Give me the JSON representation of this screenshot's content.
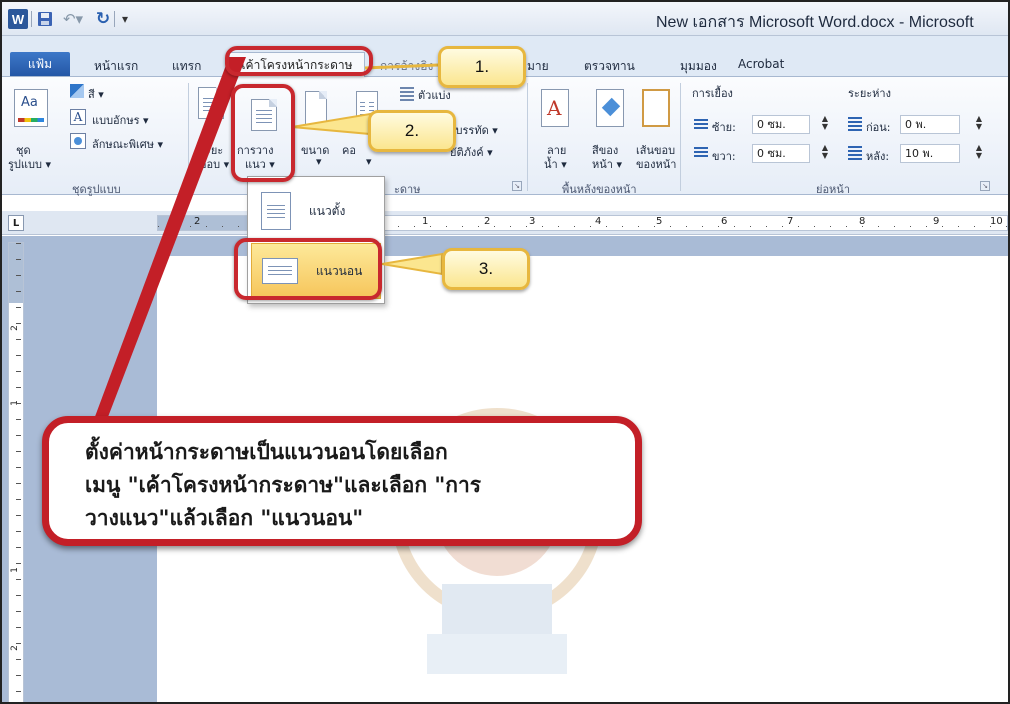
{
  "titlebar": {
    "logo_letter": "W",
    "window_title": "New เอกสาร Microsoft Word.docx - Microsoft",
    "qa_menu_glyph": "▾"
  },
  "tabs": {
    "file": "แฟ้ม",
    "home": "หน้าแรก",
    "insert": "แทรก",
    "page_layout": "เค้าโครงหน้ากระดาษ",
    "references_partial": "การอ้างอิง",
    "mailings_partial": "มาย",
    "review": "ตรวจทาน",
    "view": "มุมมอง",
    "acrobat": "Acrobat"
  },
  "ribbon": {
    "themes": {
      "themes_label_line1": "ชุด",
      "themes_label_line2": "รูปแบบ ▾",
      "colors": "สี ▾",
      "fonts": "แบบอักษร ▾",
      "effects": "ลักษณะพิเศษ ▾",
      "group_label": "ชุดรูปแบบ"
    },
    "page_setup": {
      "margins_line1": "ระยะ",
      "margins_line2": "ขอบ ▾",
      "orientation_line1": "การวาง",
      "orientation_line2": "แนว ▾",
      "size": "ขนาด",
      "columns_partial": "คอ",
      "breaks_partial": "ตัวแบ่ง",
      "line_numbers_partial": "ขบรรทัด ▾",
      "hyphenation_partial": "ยัติภังค์ ▾",
      "group_label_partial": "ะดาษ"
    },
    "page_background": {
      "watermark_line1": "ลาย",
      "watermark_line2": "น้ำ ▾",
      "page_color_line1": "สีของ",
      "page_color_line2": "หน้า ▾",
      "page_borders_line1": "เส้นขอบ",
      "page_borders_line2": "ของหน้า",
      "group_label": "พื้นหลังของหน้า"
    },
    "paragraph": {
      "indent_title": "การเยื้อง",
      "indent_left_label": "ซ้าย:",
      "indent_left_value": "0 ซม.",
      "indent_right_label": "ขวา:",
      "indent_right_value": "0 ซม.",
      "spacing_title": "ระยะห่าง",
      "spacing_before_label": "ก่อน:",
      "spacing_before_value": "0 พ.",
      "spacing_after_label": "หลัง:",
      "spacing_after_value": "10 พ.",
      "group_label": "ย่อหน้า"
    }
  },
  "dropdown": {
    "portrait": "แนวตั้ง",
    "landscape": "แนวนอน"
  },
  "ruler": {
    "tab_selector": "L",
    "h_numbers": [
      "2",
      "1",
      "1",
      "2",
      "3",
      "4",
      "5",
      "6",
      "7",
      "8",
      "9",
      "10"
    ],
    "v_numbers": [
      "2",
      "1",
      "1",
      "2"
    ]
  },
  "callouts": {
    "step1": "1.",
    "step2": "2.",
    "step3": "3.",
    "main_line1": "ตั้งค่าหน้ากระดาษเป็นแนวนอนโดยเลือก",
    "main_line2": "เมนู \"เค้าโครงหน้ากระดาษ\"และเลือก \"การ",
    "main_line3": "วางแนว\"แล้วเลือก \"แนวนอน\""
  },
  "colors": {
    "callout_red": "#c31f27",
    "callout_yellow": "#fbe68f",
    "highlight_orange": "#f6c55a",
    "word_blue": "#2b579a"
  }
}
